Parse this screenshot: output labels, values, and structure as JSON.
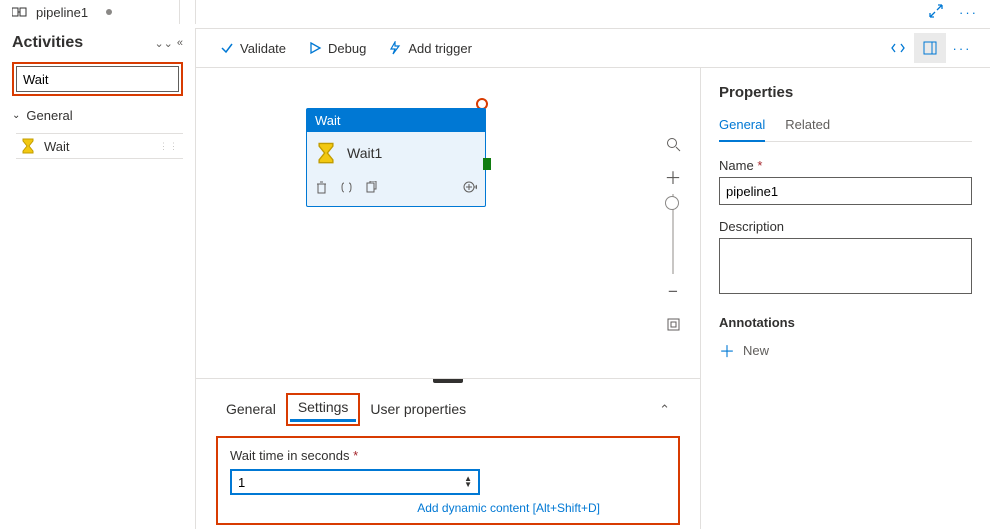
{
  "tab": {
    "icon": "pipeline-icon",
    "title": "pipeline1"
  },
  "activities": {
    "title": "Activities",
    "search_value": "Wait",
    "group_label": "General",
    "item_label": "Wait"
  },
  "toolbar": {
    "validate": "Validate",
    "debug": "Debug",
    "add_trigger": "Add trigger"
  },
  "canvas": {
    "node_type": "Wait",
    "node_name": "Wait1"
  },
  "details": {
    "tabs": {
      "general": "General",
      "settings": "Settings",
      "user_props": "User properties"
    },
    "wait_label": "Wait time in seconds",
    "wait_value": "1",
    "dynamic_link": "Add dynamic content [Alt+Shift+D]"
  },
  "properties": {
    "title": "Properties",
    "tabs": {
      "general": "General",
      "related": "Related"
    },
    "name_label": "Name",
    "name_value": "pipeline1",
    "desc_label": "Description",
    "ann_label": "Annotations",
    "new_label": "New"
  }
}
